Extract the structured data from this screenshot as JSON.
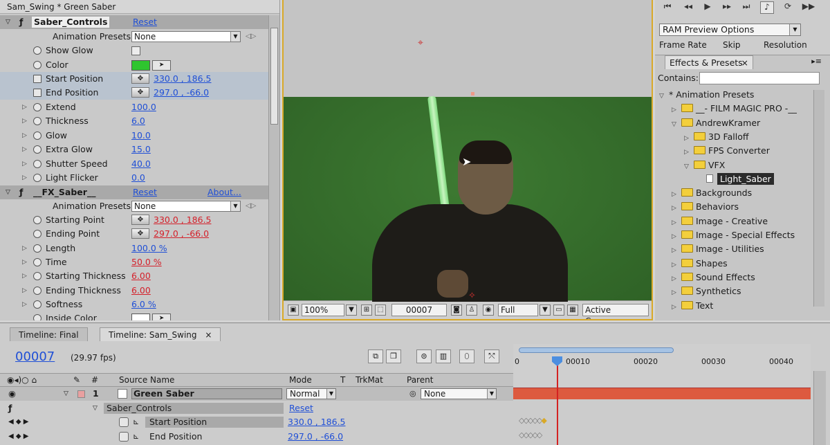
{
  "effect_controls": {
    "title": "Sam_Swing * Green Saber",
    "group1": {
      "name": "Saber_Controls",
      "reset": "Reset",
      "presets_label": "Animation Presets:",
      "presets_value": "None"
    },
    "props1": [
      {
        "label": "Show Glow",
        "value": ""
      },
      {
        "label": "Color",
        "value": ""
      },
      {
        "label": "Start Position",
        "value": "330.0 , 186.5"
      },
      {
        "label": "End Position",
        "value": "297.0 , -66.0"
      },
      {
        "label": "Extend",
        "value": "100.0"
      },
      {
        "label": "Thickness",
        "value": "6.0"
      },
      {
        "label": "Glow",
        "value": "10.0"
      },
      {
        "label": "Extra Glow",
        "value": "15.0"
      },
      {
        "label": "Shutter Speed",
        "value": "40.0"
      },
      {
        "label": "Light Flicker",
        "value": "0.0"
      }
    ],
    "group2": {
      "name": "__FX_Saber__",
      "reset": "Reset",
      "about": "About...",
      "presets_label": "Animation Presets:",
      "presets_value": "None"
    },
    "props2": [
      {
        "label": "Starting Point",
        "value": "330.0 , 186.5"
      },
      {
        "label": "Ending Point",
        "value": "297.0 , -66.0"
      },
      {
        "label": "Length",
        "value": "100.0 %"
      },
      {
        "label": "Time",
        "value": "50.0 %"
      },
      {
        "label": "Starting Thickness",
        "value": "6.00"
      },
      {
        "label": "Ending Thickness",
        "value": "6.00"
      },
      {
        "label": "Softness",
        "value": "6.0 %"
      },
      {
        "label": "Inside Color",
        "value": ""
      }
    ],
    "color_swatch": "#2fc52f"
  },
  "comp": {
    "zoom": "100%",
    "timecode": "00007",
    "resolution": "Full",
    "camera": "Active Camera"
  },
  "preview": {
    "ram_options": "RAM Preview Options",
    "frame_rate": "Frame Rate",
    "skip": "Skip",
    "resolution": "Resolution"
  },
  "effects_presets": {
    "tab": "Effects & Presets",
    "contains_label": "Contains:",
    "tree": [
      {
        "label": "* Animation Presets",
        "depth": 0,
        "type": "root"
      },
      {
        "label": "__- FILM MAGIC PRO -__",
        "depth": 1,
        "type": "folder"
      },
      {
        "label": "AndrewKramer",
        "depth": 1,
        "type": "folder-open"
      },
      {
        "label": "3D Falloff",
        "depth": 2,
        "type": "folder"
      },
      {
        "label": "FPS Converter",
        "depth": 2,
        "type": "folder"
      },
      {
        "label": "VFX",
        "depth": 2,
        "type": "folder-open"
      },
      {
        "label": "Light_Saber",
        "depth": 3,
        "type": "file"
      },
      {
        "label": "Backgrounds",
        "depth": 1,
        "type": "folder"
      },
      {
        "label": "Behaviors",
        "depth": 1,
        "type": "folder"
      },
      {
        "label": "Image - Creative",
        "depth": 1,
        "type": "folder"
      },
      {
        "label": "Image - Special Effects",
        "depth": 1,
        "type": "folder"
      },
      {
        "label": "Image - Utilities",
        "depth": 1,
        "type": "folder"
      },
      {
        "label": "Shapes",
        "depth": 1,
        "type": "folder"
      },
      {
        "label": "Sound Effects",
        "depth": 1,
        "type": "folder"
      },
      {
        "label": "Synthetics",
        "depth": 1,
        "type": "folder"
      },
      {
        "label": "Text",
        "depth": 1,
        "type": "folder"
      }
    ]
  },
  "timeline": {
    "tabs": [
      "Timeline: Final",
      "Timeline: Sam_Swing"
    ],
    "timecode": "00007",
    "fps": "(29.97 fps)",
    "columns": {
      "num": "#",
      "source": "Source Name",
      "mode": "Mode",
      "t": "T",
      "trkmat": "TrkMat",
      "parent": "Parent"
    },
    "layer": {
      "num": "1",
      "name": "Green Saber",
      "mode": "Normal",
      "parent": "None"
    },
    "effect": {
      "name": "Saber_Controls",
      "reset": "Reset"
    },
    "sub": [
      {
        "label": "Start Position",
        "value": "330.0 , 186.5"
      },
      {
        "label": "End Position",
        "value": "297.0 , -66.0"
      }
    ],
    "ruler_ticks": [
      "0",
      "00010",
      "00020",
      "00030",
      "00040"
    ]
  },
  "colors": {
    "accent_blue": "#1f4fd6",
    "keyframe_red": "#d4202a",
    "layer_bar": "#dd5a3f",
    "comp_border": "#d9a928"
  }
}
